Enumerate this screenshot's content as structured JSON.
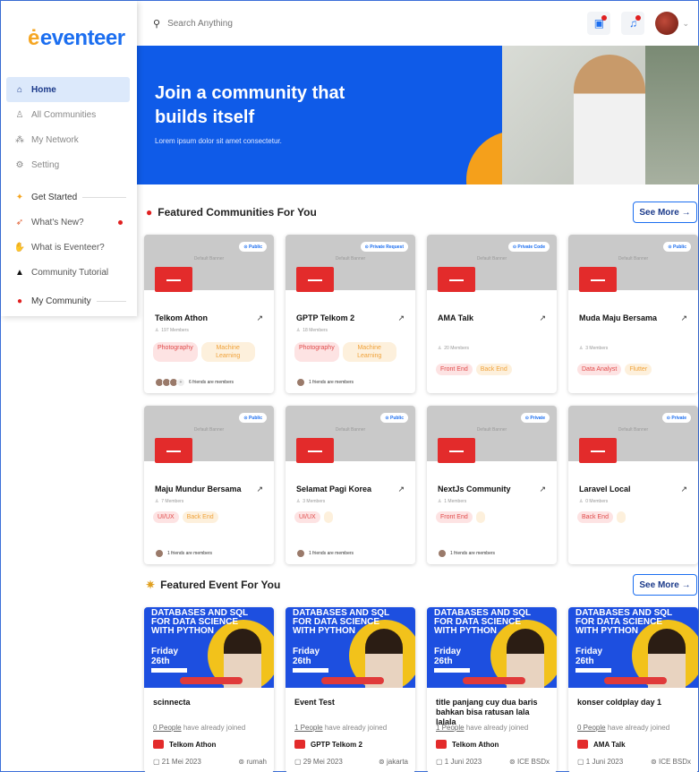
{
  "sidebar": {
    "logo": "eventeer",
    "items": [
      {
        "label": "Home",
        "icon": "home-icon",
        "glyph": "⌂"
      },
      {
        "label": "All Communities",
        "icon": "users-icon",
        "glyph": "♙"
      },
      {
        "label": "My Network",
        "icon": "network-icon",
        "glyph": "⁂"
      },
      {
        "label": "Setting",
        "icon": "gear-icon",
        "glyph": "⚙"
      }
    ],
    "get_started": "Get Started",
    "extras": [
      {
        "label": "What's New?",
        "icon": "rocket-icon",
        "glyph": "🚀"
      },
      {
        "label": "What is Eventeer?",
        "icon": "hands-icon",
        "glyph": "👐"
      },
      {
        "label": "Community Tutorial",
        "icon": "graduation-cap-icon",
        "glyph": "🎓"
      }
    ],
    "my_community": "My Community"
  },
  "header": {
    "search_placeholder": "Search Anything"
  },
  "hero": {
    "title": "Join a community that builds itself",
    "subtitle": "Lorem ipsum dolor sit amet consectetur."
  },
  "communities_section": {
    "title": "Featured Communities For You",
    "see_more": "See More"
  },
  "communities": [
    {
      "name": "Telkom Athon",
      "members": "197 Members",
      "privacy": "Public",
      "tags": [
        [
          "Photography",
          "red"
        ],
        [
          "Machine Learning",
          "orange"
        ]
      ],
      "friends": "6 friends are members",
      "avatars": 3
    },
    {
      "name": "GPTP Telkom 2",
      "members": "18 Members",
      "privacy": "Private Request",
      "tags": [
        [
          "Photography",
          "red"
        ],
        [
          "Machine Learning",
          "orange"
        ]
      ],
      "friends": "1 friends are members",
      "avatars": 1
    },
    {
      "name": "AMA Talk",
      "members": "20 Members",
      "privacy": "Private Code",
      "tags": [
        [
          "Front End",
          "red"
        ],
        [
          "Back End",
          "orange"
        ]
      ],
      "friends": "",
      "avatars": 0
    },
    {
      "name": "Muda Maju Bersama",
      "members": "3 Members",
      "privacy": "Public",
      "tags": [
        [
          "Data Analyst",
          "red"
        ],
        [
          "Flutter",
          "orange"
        ]
      ],
      "friends": "",
      "avatars": 0
    },
    {
      "name": "Maju Mundur Bersama",
      "members": "7 Members",
      "privacy": "Public",
      "tags": [
        [
          "UI/UX",
          "red"
        ],
        [
          "Back End",
          "orange"
        ]
      ],
      "friends": "1 friends are members",
      "avatars": 1
    },
    {
      "name": "Selamat Pagi Korea",
      "members": "3 Members",
      "privacy": "Public",
      "tags": [
        [
          "UI/UX",
          "red"
        ],
        [
          "",
          "orange"
        ]
      ],
      "friends": "1 friends are members",
      "avatars": 1
    },
    {
      "name": "NextJs Community",
      "members": "1 Members",
      "privacy": "Private",
      "tags": [
        [
          "Front End",
          "red"
        ],
        [
          "",
          "orange"
        ]
      ],
      "friends": "1 friends are members",
      "avatars": 1
    },
    {
      "name": "Laravel Local",
      "members": "0 Members",
      "privacy": "Private",
      "tags": [
        [
          "Back End",
          "red"
        ],
        [
          "",
          "orange"
        ]
      ],
      "friends": "",
      "avatars": 0
    }
  ],
  "banner_placeholder": "Default Banner",
  "events_section": {
    "title": "Featured Event For You",
    "see_more": "See More"
  },
  "poster": {
    "headline": "DATABASES AND SQL FOR DATA SCIENCE WITH PYTHON",
    "day": "Friday",
    "date": "26th"
  },
  "events": [
    {
      "name": "scinnecta",
      "joined_count": "0 People",
      "joined_suffix": " have already joined",
      "org": "Telkom Athon",
      "date": "21 Mei 2023",
      "location": "rumah"
    },
    {
      "name": "Event Test",
      "joined_count": "1 People",
      "joined_suffix": " have already joined",
      "org": "GPTP Telkom 2",
      "date": "29 Mei 2023",
      "location": "jakarta"
    },
    {
      "name": "title panjang cuy dua baris bahkan bisa ratusan lala lalala",
      "joined_count": "1 People",
      "joined_suffix": " have already joined",
      "org": "Telkom Athon",
      "date": "1 Juni 2023",
      "location": "ICE BSDx"
    },
    {
      "name": "konser coldplay day 1",
      "joined_count": "0 People",
      "joined_suffix": " have already joined",
      "org": "AMA Talk",
      "date": "1 Juni 2023",
      "location": "ICE BSDx"
    }
  ]
}
